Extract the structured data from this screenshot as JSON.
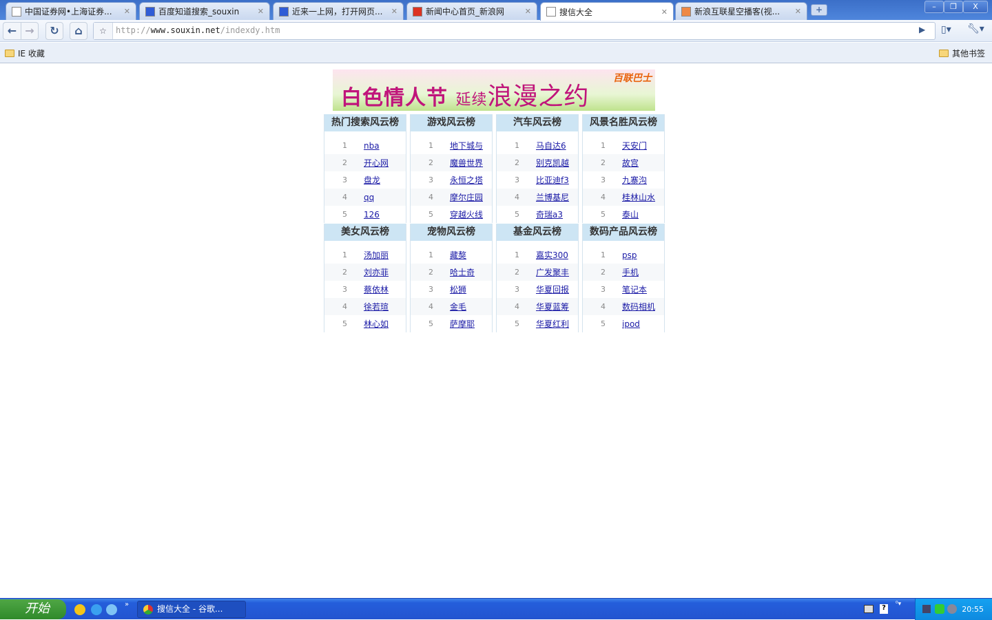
{
  "browser": {
    "tabs": [
      {
        "title": "中国证券网•上海证券...",
        "icon": "page-icon"
      },
      {
        "title": "百度知道搜索_souxin",
        "icon": "baidu-paw-icon"
      },
      {
        "title": "近来一上网，打开网页...",
        "icon": "baidu-paw-icon"
      },
      {
        "title": "新闻中心首页_新浪网",
        "icon": "sina-eye-icon"
      },
      {
        "title": "搜信大全",
        "icon": "page-icon",
        "active": true
      },
      {
        "title": "新浪互联星空播客(视...",
        "icon": "sina-podcast-icon"
      }
    ],
    "url_prefix": "http://",
    "url_host": "www.souxin.net",
    "url_path": "/indexdy.htm",
    "bookmarks": {
      "left": "IE 收藏",
      "right": "其他书签"
    }
  },
  "banner": {
    "text_a": "白色情人节",
    "text_b": "延续",
    "text_c": "浪漫之约",
    "brand": "百联巴士"
  },
  "boards": [
    {
      "title": "热门搜索风云榜",
      "items": [
        "nba",
        "开心网",
        "盘龙",
        "qq",
        "126"
      ]
    },
    {
      "title": "游戏风云榜",
      "items": [
        "地下城与",
        "魔兽世界",
        "永恒之塔",
        "摩尔庄园",
        "穿越火线"
      ]
    },
    {
      "title": "汽车风云榜",
      "items": [
        "马自达6",
        "别克凯越",
        "比亚迪f3",
        "兰博基尼",
        "奇瑞a3"
      ]
    },
    {
      "title": "风景名胜风云榜",
      "items": [
        "天安门",
        "故宫",
        "九寨沟",
        "桂林山水",
        "泰山"
      ]
    },
    {
      "title": "美女风云榜",
      "items": [
        "汤加丽",
        "刘亦菲",
        "蔡依林",
        "徐若瑄",
        "林心如"
      ]
    },
    {
      "title": "宠物风云榜",
      "items": [
        "藏獒",
        "哈士奇",
        "松狮",
        "金毛",
        "萨摩耶"
      ]
    },
    {
      "title": "基金风云榜",
      "items": [
        "嘉实300",
        "广发聚丰",
        "华夏回报",
        "华夏蓝筹",
        "华夏红利"
      ]
    },
    {
      "title": "数码产品风云榜",
      "items": [
        "psp",
        "手机",
        "笔记本",
        "数码相机",
        "ipod"
      ]
    }
  ],
  "taskbar": {
    "start": "开始",
    "window": "搜信大全 - 谷歌...",
    "clock": "20:55"
  }
}
